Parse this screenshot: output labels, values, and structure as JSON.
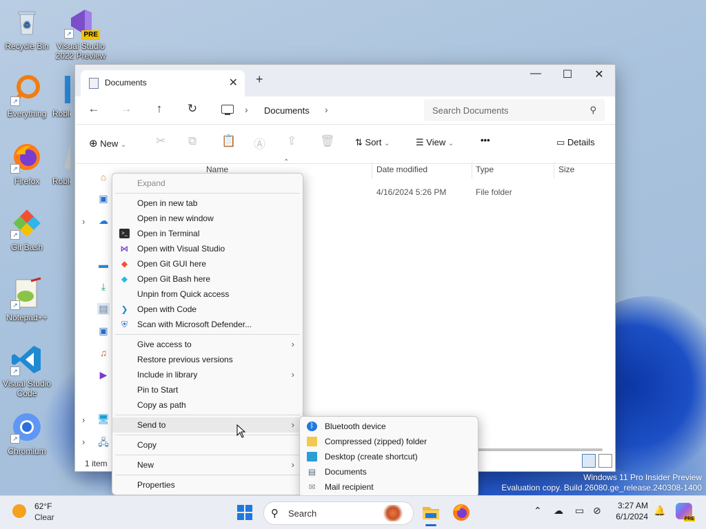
{
  "desktop": {
    "icons": [
      {
        "label": "Recycle Bin"
      },
      {
        "label": "Visual Studio 2022 Preview",
        "badge": "PRE"
      },
      {
        "label": "Everything"
      },
      {
        "label": "Roblo"
      },
      {
        "label": "Firefox"
      },
      {
        "label": "Roblo"
      },
      {
        "label": "Git Bash"
      },
      {
        "label": "Notepad++"
      },
      {
        "label": "Visual Studio Code"
      },
      {
        "label": "Chromium"
      }
    ]
  },
  "explorer": {
    "tab_title": "Documents",
    "new_tab": "+",
    "window_controls": {
      "minimize": "—",
      "maximize": "☐",
      "close": "✕"
    },
    "breadcrumb": {
      "separator": "›",
      "current": "Documents"
    },
    "search_placeholder": "Search Documents",
    "commands": {
      "new": "New",
      "sort": "Sort",
      "view": "View",
      "more": "•••",
      "details": "Details"
    },
    "columns": {
      "name": "Name",
      "date_modified": "Date modified",
      "type": "Type",
      "size": "Size"
    },
    "rows": [
      {
        "date_modified": "4/16/2024 5:26 PM",
        "type": "File folder"
      }
    ],
    "status": "1 item"
  },
  "context_menu": {
    "items": [
      {
        "label": "Expand",
        "disabled": true
      },
      {
        "label": "Open in new tab"
      },
      {
        "label": "Open in new window"
      },
      {
        "label": "Open in Terminal",
        "icon": "terminal-icon"
      },
      {
        "label": "Open with Visual Studio",
        "icon": "visual-studio-icon"
      },
      {
        "label": "Open Git GUI here",
        "icon": "git-icon"
      },
      {
        "label": "Open Git Bash here",
        "icon": "git-icon"
      },
      {
        "label": "Unpin from Quick access"
      },
      {
        "label": "Open with Code",
        "icon": "vscode-icon"
      },
      {
        "label": "Scan with Microsoft Defender...",
        "icon": "defender-icon"
      },
      {
        "label": "Give access to",
        "submenu": true
      },
      {
        "label": "Restore previous versions"
      },
      {
        "label": "Include in library",
        "submenu": true
      },
      {
        "label": "Pin to Start"
      },
      {
        "label": "Copy as path"
      },
      {
        "label": "Send to",
        "submenu": true,
        "highlighted": true
      },
      {
        "label": "Copy"
      },
      {
        "label": "New",
        "submenu": true
      },
      {
        "label": "Properties"
      }
    ]
  },
  "send_to_menu": {
    "items": [
      {
        "label": "Bluetooth device",
        "icon": "bluetooth-icon"
      },
      {
        "label": "Compressed (zipped) folder",
        "icon": "zip-folder-icon"
      },
      {
        "label": "Desktop (create shortcut)",
        "icon": "desktop-icon"
      },
      {
        "label": "Documents",
        "icon": "documents-icon"
      },
      {
        "label": "Mail recipient",
        "icon": "mail-icon"
      }
    ]
  },
  "watermark": {
    "line1": "Windows 11 Pro Insider Preview",
    "line2": "Evaluation copy. Build 26080.ge_release.240308-1400"
  },
  "taskbar": {
    "weather_temp": "62°F",
    "weather_condition": "Clear",
    "search_label": "Search",
    "time": "3:27 AM",
    "date": "6/1/2024"
  },
  "colors": {
    "accent": "#1e78e0",
    "menu_bg": "#f9f9f9",
    "taskbar_bg": "#eaeef4"
  }
}
